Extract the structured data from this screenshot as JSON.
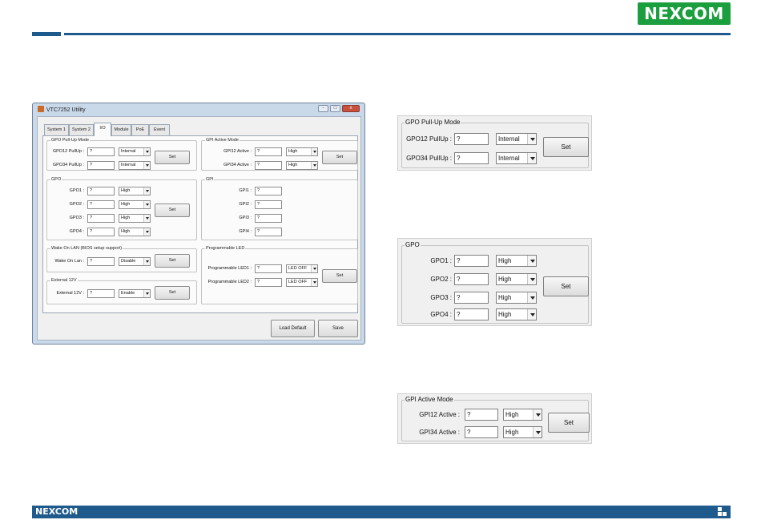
{
  "brand": {
    "logo_text": "NEXCOM",
    "footer_logo_text": "NEXCOM",
    "color": "#1b9e3e",
    "bar_color": "#1f5a8c"
  },
  "window": {
    "title": "VTC7252 Utility",
    "icon": "app-icon",
    "controls": {
      "minimize": "-",
      "maximize": "□",
      "close": "x"
    },
    "tabs": [
      "System 1",
      "System 2",
      "I/O",
      "Module",
      "PoE",
      "Event"
    ],
    "active_tab": "I/O",
    "gpo_pullup": {
      "title": "GPO Pull-Up Mode",
      "rows": [
        {
          "label": "GPO12 PullUp :",
          "value": "?",
          "select": "Internal"
        },
        {
          "label": "GPO34 PullUp :",
          "value": "?",
          "select": "Internal"
        }
      ],
      "set_label": "Set"
    },
    "gpi_active": {
      "title": "GPI Active Mode",
      "rows": [
        {
          "label": "GPI12 Active :",
          "value": "?",
          "select": "High"
        },
        {
          "label": "GPI34 Active :",
          "value": "?",
          "select": "High"
        }
      ],
      "set_label": "Set"
    },
    "gpo": {
      "title": "GPO",
      "rows": [
        {
          "label": "GPO1 :",
          "value": "?",
          "select": "High"
        },
        {
          "label": "GPO2 :",
          "value": "?",
          "select": "High"
        },
        {
          "label": "GPO3 :",
          "value": "?",
          "select": "High"
        },
        {
          "label": "GPO4 :",
          "value": "?",
          "select": "High"
        }
      ],
      "set_label": "Set"
    },
    "gpi": {
      "title": "GPI",
      "rows": [
        {
          "label": "GPI1 :",
          "value": "?"
        },
        {
          "label": "GPI2 :",
          "value": "?"
        },
        {
          "label": "GPI3 :",
          "value": "?"
        },
        {
          "label": "GPI4 :",
          "value": "?"
        }
      ]
    },
    "wol": {
      "title": "Wake On LAN (BIOS setup support)",
      "label": "Wake On Lan :",
      "value": "?",
      "select": "Disable",
      "set_label": "Set"
    },
    "ext12v": {
      "title": "External 12V",
      "label": "External 12V :",
      "value": "?",
      "select": "Enable",
      "set_label": "Set"
    },
    "led": {
      "title": "Programmable LED",
      "rows": [
        {
          "label": "Programmable LED1 :",
          "value": "?",
          "select": "LED OFF"
        },
        {
          "label": "Programmable LED2 :",
          "value": "?",
          "select": "LED OFF"
        }
      ],
      "set_label": "Set"
    },
    "load_default_label": "Load Default",
    "save_label": "Save"
  },
  "zoom_pullup": {
    "title": "GPO Pull-Up Mode",
    "rows": [
      {
        "label": "GPO12 PullUp :",
        "value": "?",
        "select": "Internal"
      },
      {
        "label": "GPO34 PullUp :",
        "value": "?",
        "select": "Internal"
      }
    ],
    "set_label": "Set"
  },
  "zoom_gpo": {
    "title": "GPO",
    "rows": [
      {
        "label": "GPO1 :",
        "value": "?",
        "select": "High"
      },
      {
        "label": "GPO2 :",
        "value": "?",
        "select": "High"
      },
      {
        "label": "GPO3 :",
        "value": "?",
        "select": "High"
      },
      {
        "label": "GPO4 :",
        "value": "?",
        "select": "High"
      }
    ],
    "set_label": "Set"
  },
  "zoom_gpi_active": {
    "title": "GPI Active Mode",
    "rows": [
      {
        "label": "GPI12 Active :",
        "value": "?",
        "select": "High"
      },
      {
        "label": "GPI34 Active :",
        "value": "?",
        "select": "High"
      }
    ],
    "set_label": "Set"
  }
}
